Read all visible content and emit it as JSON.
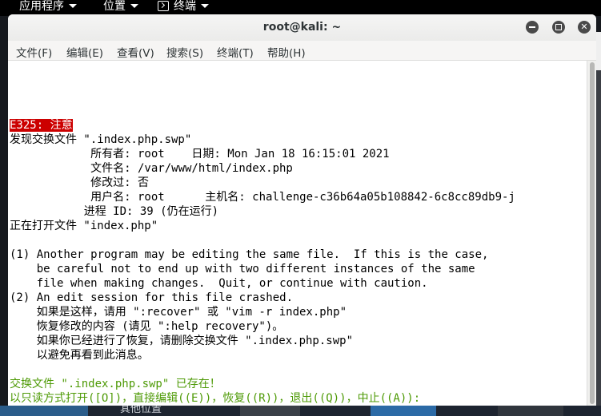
{
  "panel": {
    "apps_label": "应用程序",
    "places_label": "位置",
    "terminal_label": "终端"
  },
  "desktop": {
    "bottom_label": "其他位置"
  },
  "window": {
    "title": "root@kali: ~",
    "min_symbol": "",
    "max_symbol": "",
    "close_symbol": "✕"
  },
  "menu": {
    "file": "文件(F)",
    "edit": "编辑(E)",
    "view": "查看(V)",
    "search": "搜索(S)",
    "terminal": "终端(T)",
    "help": "帮助(H)"
  },
  "terminal": {
    "error_label": "E325: 注意",
    "lines": [
      "发现交换文件 \".index.php.swp\"",
      "            所有者: root    日期: Mon Jan 18 16:15:01 2021",
      "            文件名: /var/www/html/index.php",
      "            修改过: 否",
      "            用户名: root      主机名: challenge-c36b64a05b108842-6c8cc89db9-j",
      "           进程 ID: 39 (仍在运行)",
      "正在打开文件 \"index.php\"",
      "",
      "(1) Another program may be editing the same file.  If this is the case,",
      "    be careful not to end up with two different instances of the same",
      "    file when making changes.  Quit, or continue with caution.",
      "(2) An edit session for this file crashed.",
      "    如果是这样，请用 \":recover\" 或 \"vim -r index.php\"",
      "    恢复修改的内容 (请见 \":help recovery\")。",
      "    如果你已经进行了恢复，请删除交换文件 \".index.php.swp\"",
      "    以避免再看到此消息。",
      ""
    ],
    "prompt_exists": "交换文件 \".index.php.swp\" 已存在！",
    "prompt_options": "以只读方式打开([O])，直接编辑((E))，恢复((R))，退出((Q))，中止((A)):"
  }
}
